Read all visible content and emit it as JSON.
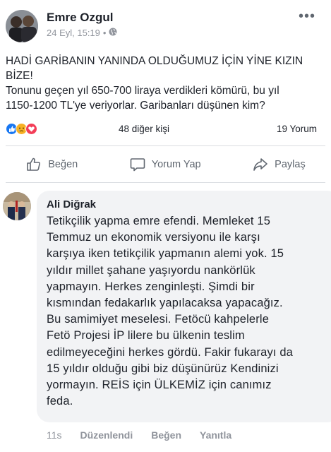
{
  "post": {
    "author": "Emre Ozgul",
    "date": "24 Eyl, 15:19",
    "separator": "•",
    "visibility_icon": "globe-icon",
    "more_icon": "more-dots-icon",
    "more_label": "•••",
    "text": {
      "line1": "HADİ GARİBANIN YANINDA OLDUĞUMUZ İÇİN YİNE KIZIN",
      "line2": "BİZE!",
      "line3": "Tonunu geçen yıl 650-700 liraya verdikleri kömürü, bu yıl",
      "line4": "1150-1200 TL'ye veriyorlar. Garibanları düşünen kim?"
    }
  },
  "reactions": {
    "icons": [
      "like-icon",
      "sad-icon",
      "love-icon"
    ],
    "colors": {
      "like": "#1877f2",
      "sad": "#f7b125",
      "love": "#f33e58"
    },
    "count_label": "48 diğer kişi",
    "comments_label": "19 Yorum"
  },
  "actions": {
    "like": "Beğen",
    "comment": "Yorum Yap",
    "share": "Paylaş"
  },
  "comment": {
    "author": "Ali Diğrak",
    "lines": [
      "Tetikçilik yapma emre efendi. Memleket 15",
      "Temmuz un ekonomik versiyonu ile karşı",
      "karşıya iken tetikçilik yapmanın alemi yok. 15",
      "yıldır millet şahane yaşıyordu nankörlük",
      "yapmayın. Herkes zenginleşti. Şimdi bir",
      "kısmından fedakarlık yapılacaksa yapacağız.",
      "Bu samimiyet meselesi. Fetöcü kahpelerle",
      "Fetö Projesi İP lilere bu ülkenin teslim",
      "edilmeyeceğini herkes gördü. Fakir fukarayı da",
      "15 yıldır olduğu gibi biz düşünürüz Kendinizi",
      "yormayın. REİS için ÜLKEMİZ için canımız",
      "feda."
    ],
    "time": "11s",
    "edited": "Düzenlendi",
    "like": "Beğen",
    "reply": "Yanıtla"
  }
}
